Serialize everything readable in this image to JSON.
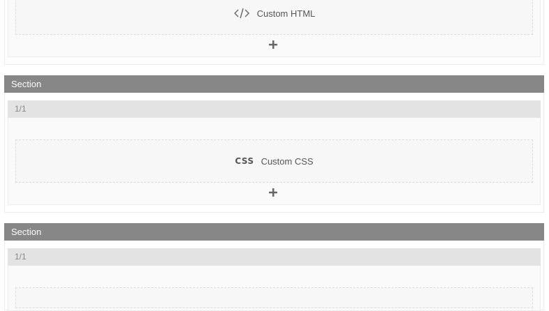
{
  "sections": [
    {
      "label": "",
      "column": "",
      "module": {
        "icon": "code-icon",
        "label": "Custom HTML"
      }
    },
    {
      "label": "Section",
      "column": "1/1",
      "module": {
        "icon": "css-icon",
        "icon_text": "CSS",
        "label": "Custom CSS"
      }
    },
    {
      "label": "Section",
      "column": "1/1",
      "module": {
        "icon": "",
        "label": ""
      }
    }
  ],
  "add_icon": "plus-icon"
}
